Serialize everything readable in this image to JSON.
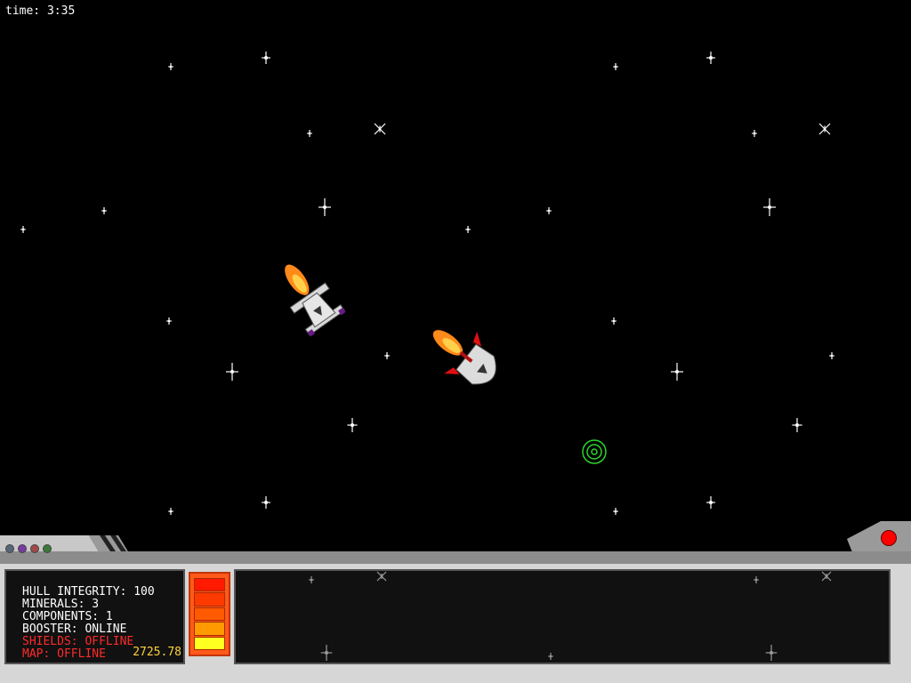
{
  "timer": {
    "label": "time: 3:35"
  },
  "status_panel": {
    "hull": "HULL INTEGRITY: 100",
    "minerals": "MINERALS: 3",
    "components": "COMPONENTS: 1",
    "booster": "BOOSTER: ONLINE",
    "shields": "SHIELDS: OFFLINE",
    "map": "MAP: OFFLINE",
    "credits": "2725.78"
  },
  "colors": {
    "background": "#000000",
    "hud_grey": "#c8c8c8",
    "panel_dark": "#111111",
    "warning_red": "#ff2a2a",
    "credits_yellow": "#ffd23c",
    "target_green": "#2bd62b"
  },
  "fuel_gauge": {
    "segments": [
      "#ff1a00",
      "#ff3a00",
      "#ff5a00",
      "#ff9a00",
      "#ffff20"
    ],
    "level_fraction": 1.0
  },
  "indicator_lights": [
    {
      "icon": "indicator-light-icon",
      "color": "#556677"
    },
    {
      "icon": "indicator-light-icon",
      "color": "#7a3aa0"
    },
    {
      "icon": "indicator-light-icon",
      "color": "#a04a4a"
    },
    {
      "icon": "indicator-light-icon",
      "color": "#3a7a3a"
    }
  ],
  "alarm_light": {
    "icon": "alarm-light-icon",
    "color": "#ff0000"
  },
  "entities": [
    {
      "icon": "player-fighter-ship-icon"
    },
    {
      "icon": "enemy-pod-ship-icon"
    },
    {
      "icon": "green-target-reticle-icon"
    }
  ]
}
